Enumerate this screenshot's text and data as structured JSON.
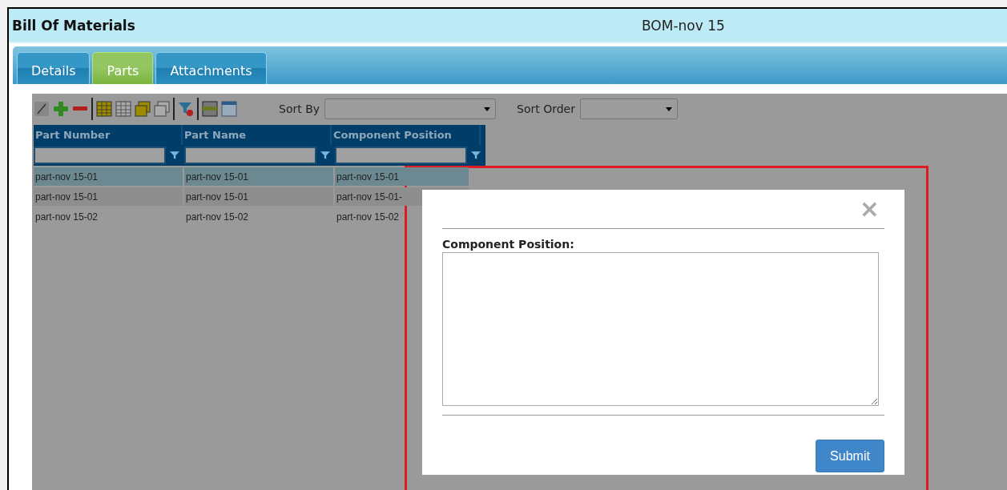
{
  "window": {
    "title": "Bill Of Materials",
    "record": "BOM-nov 15"
  },
  "tabs": [
    {
      "label": "Details",
      "selected": false
    },
    {
      "label": "Parts",
      "selected": true
    },
    {
      "label": "Attachments",
      "selected": false
    }
  ],
  "toolbar": {
    "sort_by": {
      "label": "Sort By"
    },
    "sort_order": {
      "label": "Sort Order"
    }
  },
  "table": {
    "columns": [
      "Part Number",
      "Part Name",
      "Component Position"
    ],
    "rows": [
      {
        "selected": true,
        "hovered": false,
        "cells": [
          "part-nov 15-01",
          "part-nov 15-01",
          "part-nov 15-01"
        ]
      },
      {
        "selected": false,
        "hovered": true,
        "cells": [
          "part-nov 15-01",
          "part-nov 15-01",
          "part-nov 15-01-"
        ]
      },
      {
        "selected": false,
        "hovered": false,
        "cells": [
          "part-nov 15-02",
          "part-nov 15-02",
          "part-nov 15-02"
        ]
      }
    ]
  },
  "dialog": {
    "close": "×",
    "field_label": "Component Position:",
    "submit": "Submit"
  }
}
